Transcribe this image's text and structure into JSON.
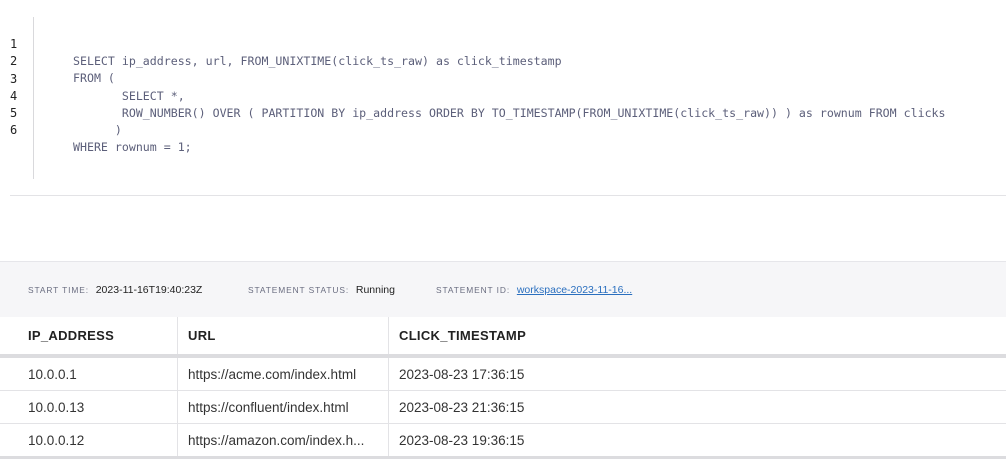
{
  "editor": {
    "lines": [
      {
        "num": "1",
        "text": "SELECT ip_address, url, FROM_UNIXTIME(click_ts_raw) as click_timestamp"
      },
      {
        "num": "2",
        "text": "FROM ("
      },
      {
        "num": "3",
        "text": "       SELECT *,"
      },
      {
        "num": "4",
        "text": "       ROW_NUMBER() OVER ( PARTITION BY ip_address ORDER BY TO_TIMESTAMP(FROM_UNIXTIME(click_ts_raw)) ) as rownum FROM clicks"
      },
      {
        "num": "5",
        "text": "      )"
      },
      {
        "num": "6",
        "text": "WHERE rownum = 1;"
      }
    ]
  },
  "statement": {
    "start_time_label": "Start time:",
    "start_time_value": "2023-11-16T19:40:23Z",
    "status_label": "Statement status:",
    "status_value": "Running",
    "id_label": "Statement ID:",
    "id_value": "workspace-2023-11-16..."
  },
  "results": {
    "columns": [
      "IP_ADDRESS",
      "URL",
      "CLICK_TIMESTAMP"
    ],
    "rows": [
      [
        "10.0.0.1",
        "https://acme.com/index.html",
        "2023-08-23 17:36:15"
      ],
      [
        "10.0.0.13",
        "https://confluent/index.html",
        "2023-08-23 21:36:15"
      ],
      [
        "10.0.0.12",
        "https://amazon.com/index.h...",
        "2023-08-23 19:36:15"
      ]
    ]
  }
}
